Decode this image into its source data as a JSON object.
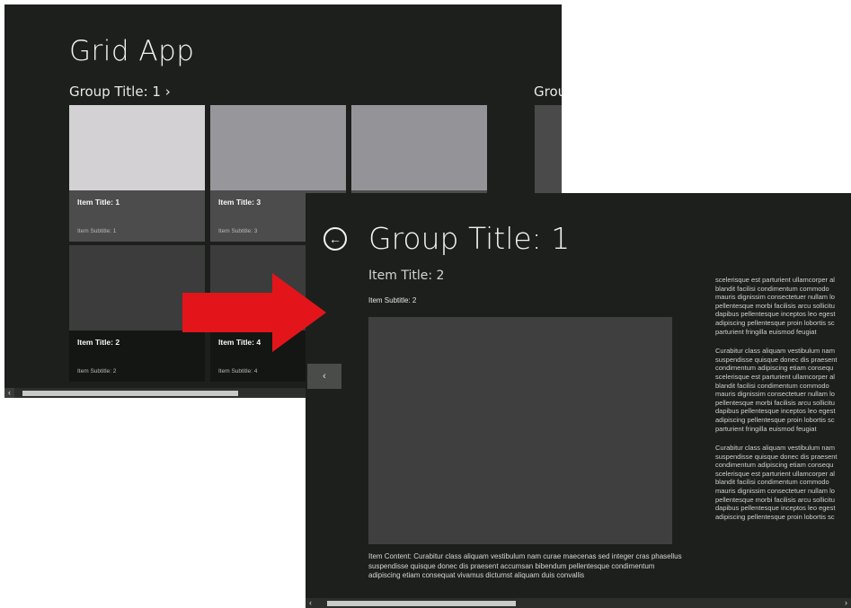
{
  "grid_app": {
    "title": "Grid App",
    "group_header": "Group Title: 1 ›",
    "group_header_2": "Grou",
    "tiles": [
      {
        "title": "Item Title: 1",
        "subtitle": "Item Subtitle: 1",
        "image_color": "#d3d1d3",
        "caption_color": "#4c4c4c"
      },
      {
        "title": "Item Title: 3",
        "subtitle": "Item Subtitle: 3",
        "image_color": "#97979b",
        "caption_color": "#4c4c4c"
      },
      {
        "title": "",
        "subtitle": "",
        "image_color": "#949498",
        "caption_color": "#4c4c4c"
      },
      {
        "title": "Item Title: 2",
        "subtitle": "Item Subtitle: 2",
        "image_color": "#3c3c3c",
        "caption_color": "#141614"
      },
      {
        "title": "Item Title: 4",
        "subtitle": "Item Subtitle: 4",
        "image_color": "#3c3c3c",
        "caption_color": "#141614"
      }
    ],
    "scroll_left_glyph": "‹"
  },
  "detail": {
    "back_glyph": "←",
    "group_title": "Group Title: 1",
    "item_title": "Item Title: 2",
    "item_subtitle": "Item Subtitle: 2",
    "item_content": "Item Content: Curabitur class aliquam vestibulum nam curae maecenas sed integer cras phasellus suspendisse quisque donec dis praesent accumsan bibendum pellentesque condimentum adipiscing etiam consequat vivamus dictumst aliquam duis convallis",
    "nav_left_glyph": "‹",
    "scroll_left_glyph": "‹",
    "scroll_right_glyph": "›",
    "right_paragraphs": [
      "scelerisque est parturient ullamcorper al\nblandit facilisi condimentum commodo\nmauris dignissim consectetuer nullam lo\npellentesque morbi facilisis arcu sollicitu\ndapibus pellentesque inceptos leo egest\nadipiscing pellentesque proin lobortis sc\nparturient fringilla euismod feugiat",
      "Curabitur class aliquam vestibulum nam\nsuspendisse quisque donec dis praesent\ncondimentum adipiscing etiam consequ\nscelerisque est parturient ullamcorper al\nblandit facilisi condimentum commodo\nmauris dignissim consectetuer nullam lo\npellentesque morbi facilisis arcu sollicitu\ndapibus pellentesque inceptos leo egest\nadipiscing pellentesque proin lobortis sc\nparturient fringilla euismod feugiat",
      "Curabitur class aliquam vestibulum nam\nsuspendisse quisque donec dis praesent\ncondimentum adipiscing etiam consequ\nscelerisque est parturient ullamcorper al\nblandit facilisi condimentum commodo\nmauris dignissim consectetuer nullam lo\npellentesque morbi facilisis arcu sollicitu\ndapibus pellentesque inceptos leo egest\nadipiscing pellentesque proin lobortis sc"
    ]
  },
  "arrow": {
    "color": "#e3151a",
    "icon": "right-arrow-icon"
  }
}
